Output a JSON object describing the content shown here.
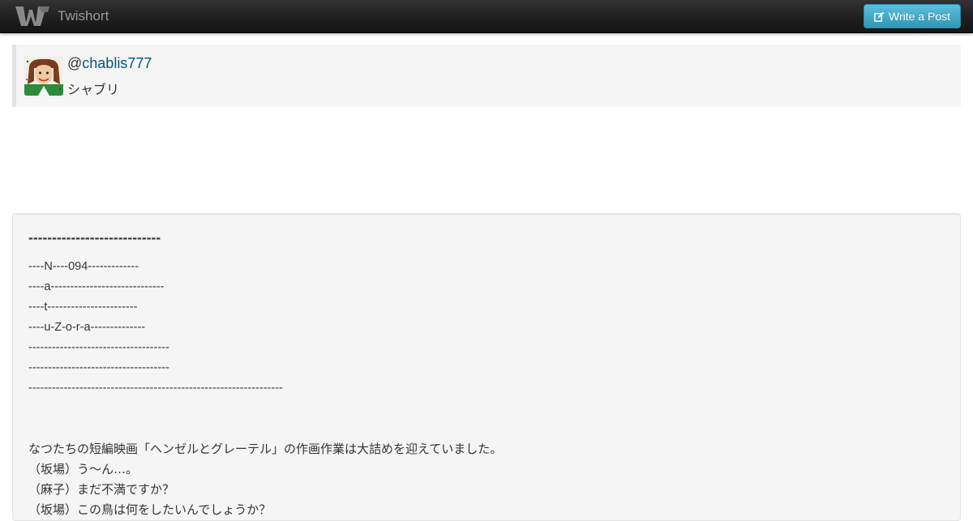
{
  "navbar": {
    "brand": "Twishort",
    "logo_icon": "twishort-logo-icon",
    "write_button_label": "Write a Post",
    "write_button_icon": "edit-icon"
  },
  "profile": {
    "at_sign": "@",
    "username": "chablis777",
    "display_name": "シャブリ",
    "avatar_icon": "avatar-image"
  },
  "post": {
    "title": "----------------------------",
    "lines": [
      "----N----094-------------",
      "----a-----------------------------",
      "----t-----------------------",
      "----u-Z-o-r-a--------------",
      "------------------------------------",
      "------------------------------------",
      "-----------------------------------------------------------------",
      "",
      "",
      "なつたちの短編映画「ヘンゼルとグレーテル」の作画作業は大詰めを迎えていました。",
      "（坂場）う～ん…。",
      "（麻子）まだ不満ですか？",
      "（坂場）この鳥は何をしたいんでしょうか？"
    ]
  },
  "colors": {
    "navbar_bg": "#1b1b1b",
    "brand_text": "#9d9d9d",
    "button_bg": "#49afcd",
    "link": "#005580",
    "panel_bg": "#f5f5f5"
  }
}
